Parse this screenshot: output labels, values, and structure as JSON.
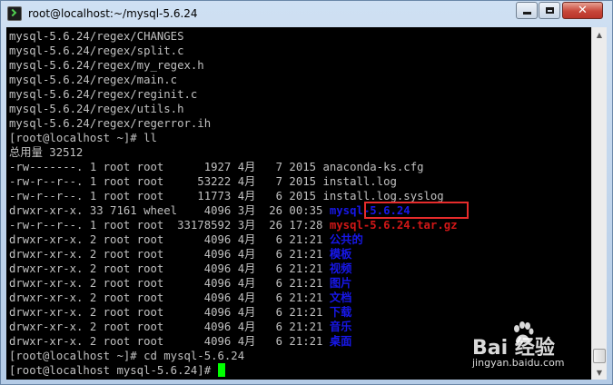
{
  "window": {
    "title": "root@localhost:~/mysql-5.6.24",
    "controls": {
      "minimize": "minimize",
      "maximize": "maximize",
      "close": "✕"
    }
  },
  "terminal": {
    "lines": [
      "mysql-5.6.24/regex/CHANGES",
      "mysql-5.6.24/regex/split.c",
      "mysql-5.6.24/regex/my_regex.h",
      "mysql-5.6.24/regex/main.c",
      "mysql-5.6.24/regex/reginit.c",
      "mysql-5.6.24/regex/utils.h",
      "mysql-5.6.24/regex/regerror.ih",
      "[root@localhost ~]# ll",
      "总用量 32512"
    ],
    "listing": [
      {
        "meta": "-rw-------. 1 root root      1927 4月   7 2015 ",
        "name": "anaconda-ks.cfg",
        "style": "normal"
      },
      {
        "meta": "-rw-r--r--. 1 root root     53222 4月   7 2015 ",
        "name": "install.log",
        "style": "normal"
      },
      {
        "meta": "-rw-r--r--. 1 root root     11773 4月   6 2015 ",
        "name": "install.log.syslog",
        "style": "normal"
      },
      {
        "meta": "drwxr-xr-x. 33 7161 wheel    4096 3月  26 00:35 ",
        "name": "mysql-5.6.24",
        "style": "blue"
      },
      {
        "meta": "-rw-r--r--. 1 root root  33178592 3月  26 17:28 ",
        "name": "mysql-5.6.24.tar.gz",
        "style": "red"
      },
      {
        "meta": "drwxr-xr-x. 2 root root      4096 4月   6 21:21 ",
        "name": "公共的",
        "style": "blue"
      },
      {
        "meta": "drwxr-xr-x. 2 root root      4096 4月   6 21:21 ",
        "name": "模板",
        "style": "blue"
      },
      {
        "meta": "drwxr-xr-x. 2 root root      4096 4月   6 21:21 ",
        "name": "视频",
        "style": "blue"
      },
      {
        "meta": "drwxr-xr-x. 2 root root      4096 4月   6 21:21 ",
        "name": "图片",
        "style": "blue"
      },
      {
        "meta": "drwxr-xr-x. 2 root root      4096 4月   6 21:21 ",
        "name": "文档",
        "style": "blue"
      },
      {
        "meta": "drwxr-xr-x. 2 root root      4096 4月   6 21:21 ",
        "name": "下载",
        "style": "blue"
      },
      {
        "meta": "drwxr-xr-x. 2 root root      4096 4月   6 21:21 ",
        "name": "音乐",
        "style": "blue"
      },
      {
        "meta": "drwxr-xr-x. 2 root root      4096 4月   6 21:21 ",
        "name": "桌面",
        "style": "blue"
      }
    ],
    "cmd_cd": "[root@localhost ~]# cd mysql-5.6.24",
    "prompt": "[root@localhost mysql-5.6.24]# "
  },
  "watermark": {
    "brand": "Bai  经验",
    "url": "jingyan.baidu.com"
  },
  "colors": {
    "terminal_bg": "#000000",
    "text": "#c0c0c0",
    "directory": "#1717e8",
    "archive": "#d01717",
    "cursor": "#00ff00",
    "highlight": "#e62b2b"
  }
}
